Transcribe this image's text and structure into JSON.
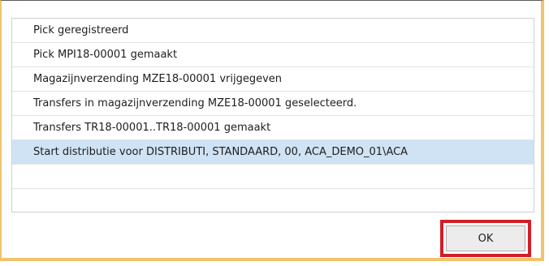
{
  "dialog": {
    "messages": [
      {
        "text": "Pick geregistreerd",
        "selected": false
      },
      {
        "text": "Pick MPI18-00001 gemaakt",
        "selected": false
      },
      {
        "text": "Magazijnverzending MZE18-00001 vrijgegeven",
        "selected": false
      },
      {
        "text": "Transfers in magazijnverzending MZE18-00001 geselecteerd.",
        "selected": false
      },
      {
        "text": "Transfers TR18-00001..TR18-00001 gemaakt",
        "selected": false
      },
      {
        "text": "Start distributie voor DISTRIBUTI, STANDAARD, 00, ACA_DEMO_01\\ACA",
        "selected": true
      },
      {
        "text": "",
        "selected": false
      },
      {
        "text": "",
        "selected": false
      }
    ],
    "ok_label": "OK"
  },
  "colors": {
    "frame_border": "#f0c46c",
    "selection": "#cfe3f4",
    "highlight": "#d21f26"
  }
}
